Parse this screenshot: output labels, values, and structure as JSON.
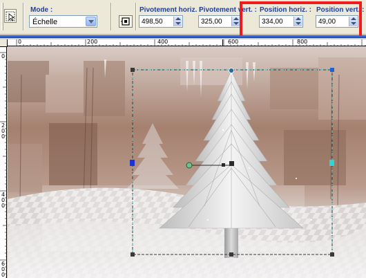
{
  "toolbar": {
    "mode_label": "Mode :",
    "mode_value": "Échelle",
    "pivot_h_label": "Pivotement horiz. :",
    "pivot_h_value": "498,50",
    "pivot_v_label": "Pivotement vert. :",
    "pivot_v_value": "325,00",
    "pos_h_label": "Position horiz. :",
    "pos_h_value": "334,00",
    "pos_v_label": "Position vert. :",
    "pos_v_value": "49,00",
    "highlight_color": "#ee1c1c",
    "tool_icon": "pick-tool-icon",
    "pin_icon": "scale-mode-pin-icon"
  },
  "rulers": {
    "horizontal": [
      "0",
      "200",
      "400",
      "600",
      "800"
    ],
    "vertical": [
      "0",
      "2\n0\n0",
      "4\n0\n0",
      "6\n0\n0"
    ]
  },
  "colors": {
    "accent_bar": "#3465d6",
    "selection_line": "#3a3a3a",
    "handle_blue": "#1c33d8",
    "handle_cyan": "#2ad6d6",
    "handle_green": "#4fa86a"
  }
}
